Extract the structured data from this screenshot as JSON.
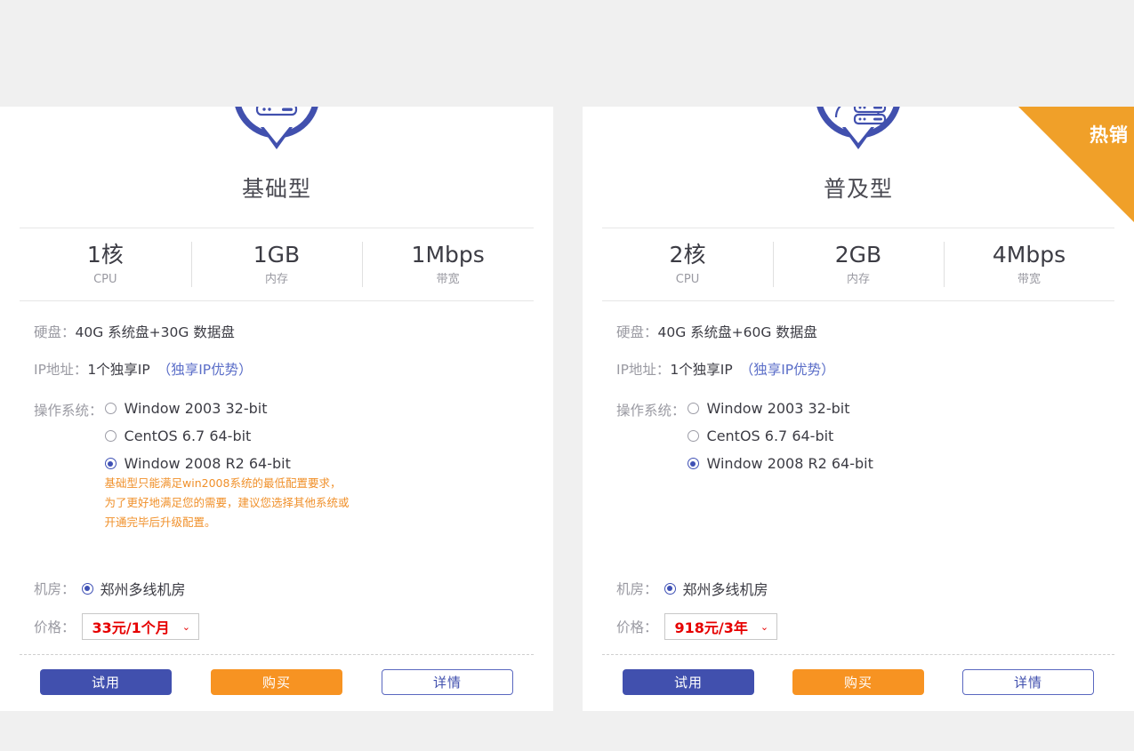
{
  "page": {
    "background": "#f0f0f0",
    "card_background": "#ffffff",
    "accent_blue": "#4150ae",
    "accent_orange": "#f79322",
    "price_red": "#e60000",
    "note_orange": "#f0902a",
    "link_blue": "#5b6ec8"
  },
  "labels": {
    "disk_key": "硬盘：",
    "ip_key": "IP地址：",
    "os_key": "操作系统：",
    "room_key": "机房：",
    "price_key": "价格：",
    "ip_link": "（独享IP优势）",
    "chevron": "⌄"
  },
  "buttons": {
    "try": "试用",
    "buy": "购买",
    "detail": "详情"
  },
  "cards": [
    {
      "id": "card-basic",
      "title": "基础型",
      "icon": "server-rack-icon",
      "badge": null,
      "specs": [
        {
          "value": "1核",
          "label": "CPU"
        },
        {
          "value": "1GB",
          "label": "内存"
        },
        {
          "value": "1Mbps",
          "label": "带宽"
        }
      ],
      "disk": "40G 系统盘+30G 数据盘",
      "ip": "1个独享IP",
      "os_options": [
        {
          "label": "Window 2003 32-bit",
          "selected": false
        },
        {
          "label": "CentOS 6.7 64-bit",
          "selected": false
        },
        {
          "label": "Window 2008 R2 64-bit",
          "selected": true
        }
      ],
      "note": "基础型只能满足win2008系统的最低配置要求，为了更好地满足您的需要，建议您选择其他系统或开通完毕后升级配置。",
      "room": "郑州多线机房",
      "price": "33元/1个月"
    },
    {
      "id": "card-popular",
      "title": "普及型",
      "icon": "user-server-icon",
      "badge": "热销",
      "specs": [
        {
          "value": "2核",
          "label": "CPU"
        },
        {
          "value": "2GB",
          "label": "内存"
        },
        {
          "value": "4Mbps",
          "label": "带宽"
        }
      ],
      "disk": "40G 系统盘+60G 数据盘",
      "ip": "1个独享IP",
      "os_options": [
        {
          "label": "Window 2003 32-bit",
          "selected": false
        },
        {
          "label": "CentOS 6.7 64-bit",
          "selected": false
        },
        {
          "label": "Window 2008 R2 64-bit",
          "selected": true
        }
      ],
      "note": null,
      "room": "郑州多线机房",
      "price": "918元/3年"
    }
  ]
}
